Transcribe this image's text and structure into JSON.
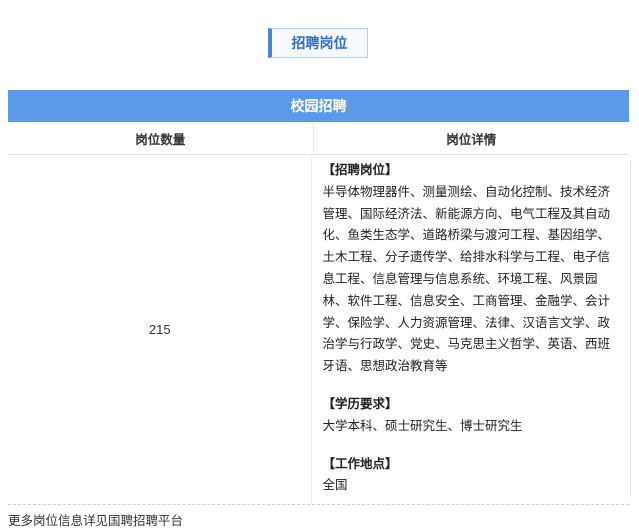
{
  "heading": "招聘岗位",
  "table": {
    "banner": "校园招聘",
    "col_count_header": "岗位数量",
    "col_detail_header": "岗位详情",
    "count": "215",
    "positions_title": "【招聘岗位】",
    "positions_text": "半导体物理器件、测量测绘、自动化控制、技术经济管理、国际经济法、新能源方向、电气工程及其自动化、鱼类生态学、道路桥梁与渡河工程、基因组学、土木工程、分子遗传学、给排水科学与工程、电子信息工程、信息管理与信息系统、环境工程、风景园林、软件工程、信息安全、工商管理、金融学、会计学、保险学、人力资源管理、法律、汉语言文学、政治学与行政学、党史、马克思主义哲学、英语、西班牙语、思想政治教育等",
    "education_title": "【学历要求】",
    "education_text": "大学本科、硕士研究生、博士研究生",
    "location_title": "【工作地点】",
    "location_text": "全国"
  },
  "footer": "更多岗位信息详见国聘招聘平台"
}
